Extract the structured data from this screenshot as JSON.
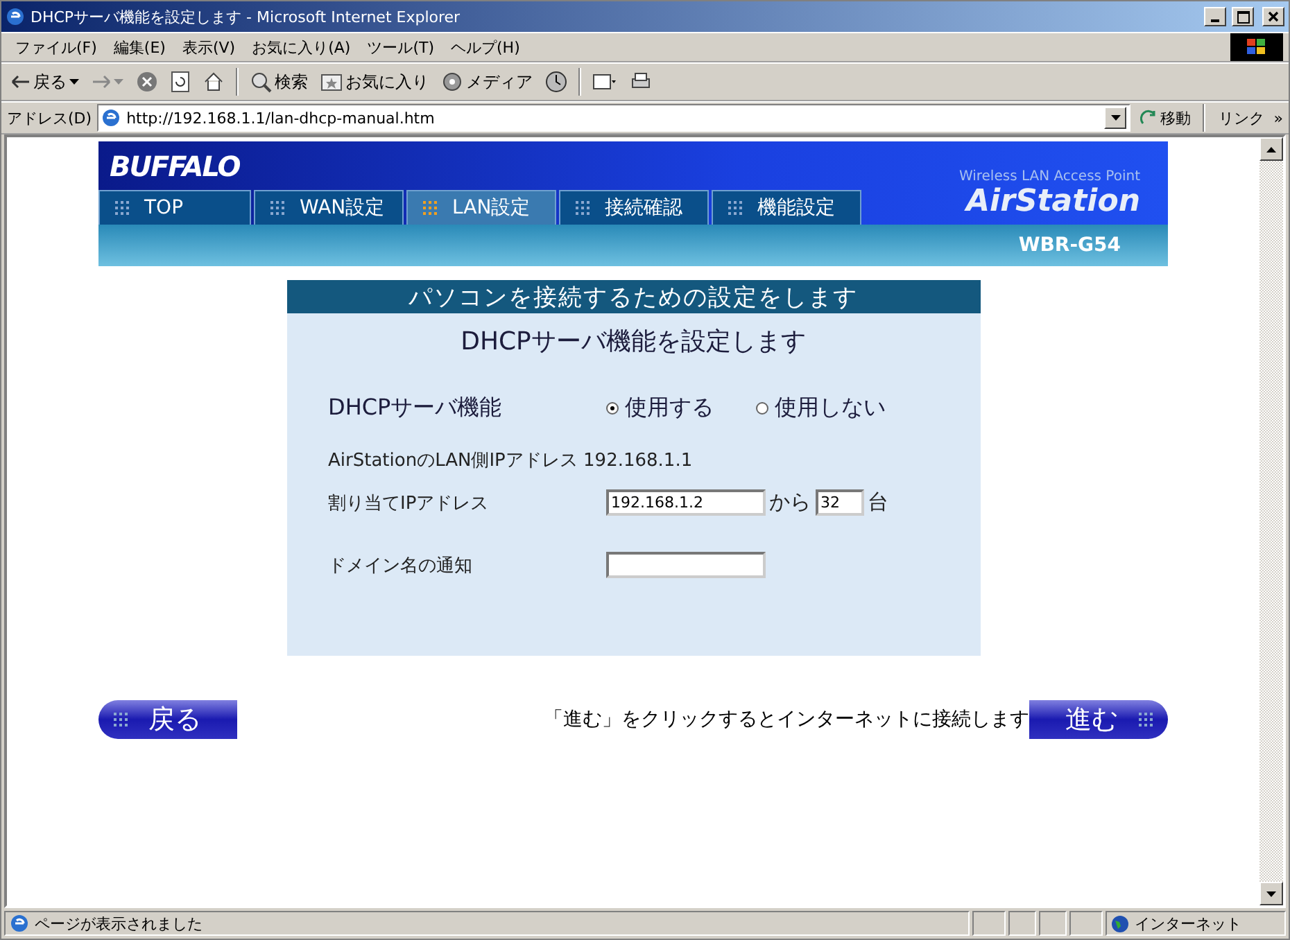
{
  "window": {
    "title": "DHCPサーバ機能を設定します - Microsoft Internet Explorer"
  },
  "menu": [
    "ファイル(F)",
    "編集(E)",
    "表示(V)",
    "お気に入り(A)",
    "ツール(T)",
    "ヘルプ(H)"
  ],
  "toolbar": {
    "back": "戻る",
    "search": "検索",
    "favorites": "お気に入り",
    "media": "メディア"
  },
  "address": {
    "label": "アドレス(D)",
    "value": "http://192.168.1.1/lan-dhcp-manual.htm",
    "go": "移動",
    "links": "リンク",
    "more": "»"
  },
  "banner": {
    "logo": "BUFFALO",
    "tagline": "Wireless LAN Access Point",
    "brand": "AirStation",
    "model": "WBR-G54",
    "tabs": [
      {
        "label": "TOP",
        "selected": false
      },
      {
        "label": "WAN設定",
        "selected": false
      },
      {
        "label": "LAN設定",
        "selected": true
      },
      {
        "label": "接続確認",
        "selected": false
      },
      {
        "label": "機能設定",
        "selected": false
      }
    ]
  },
  "panel": {
    "header": "パソコンを接続するための設定をします",
    "title": "DHCPサーバ機能を設定します",
    "dhcp_label": "DHCPサーバ機能",
    "radios": [
      {
        "label": "使用する",
        "selected": true
      },
      {
        "label": "使用しない",
        "selected": false
      }
    ],
    "lan_ip": "AirStationのLAN側IPアドレス 192.168.1.1",
    "alloc_label": "割り当てIPアドレス",
    "alloc_start": "192.168.1.2",
    "from": "から",
    "alloc_count": "32",
    "unit": "台",
    "domain_label": "ドメイン名の通知"
  },
  "footer": {
    "back": "戻る",
    "note": "「進む」をクリックするとインターネットに接続します",
    "next": "進む"
  },
  "status_bar": {
    "text": "ページが表示されました",
    "zone": "インターネット"
  }
}
